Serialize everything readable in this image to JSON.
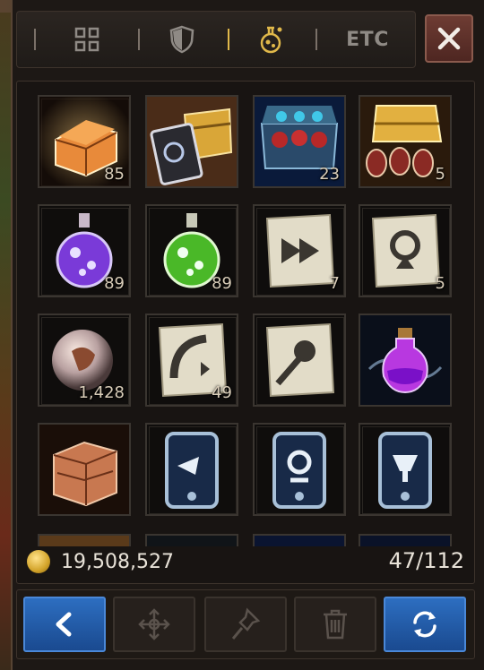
{
  "tabs": [
    {
      "label": "",
      "icon": "grid-icon"
    },
    {
      "label": "",
      "icon": "shield-icon"
    },
    {
      "label": "",
      "icon": "potion-icon",
      "active": true
    },
    {
      "label": "ETC",
      "icon": ""
    }
  ],
  "close_icon": "close-icon",
  "accent_color": "#e0b84a",
  "items": [
    {
      "name": "treasure-chest-icon",
      "qty": "85"
    },
    {
      "name": "chest-with-card-icon",
      "qty": ""
    },
    {
      "name": "gem-chest-icon",
      "qty": "23"
    },
    {
      "name": "golden-chest-icon",
      "qty": "5"
    },
    {
      "name": "purple-potion-icon",
      "qty": "89"
    },
    {
      "name": "green-potion-icon",
      "qty": "89"
    },
    {
      "name": "scroll-arrows-icon",
      "qty": "7"
    },
    {
      "name": "scroll-rune-icon",
      "qty": "5"
    },
    {
      "name": "dragon-orb-icon",
      "qty": "1,428"
    },
    {
      "name": "scroll-curve-icon",
      "qty": "49"
    },
    {
      "name": "scroll-arrow-icon",
      "qty": ""
    },
    {
      "name": "magic-elixir-icon",
      "qty": ""
    },
    {
      "name": "wooden-chest-icon",
      "qty": ""
    },
    {
      "name": "skill-card-wave-icon",
      "qty": ""
    },
    {
      "name": "skill-card-spiral-icon",
      "qty": ""
    },
    {
      "name": "skill-card-cup-icon",
      "qty": ""
    }
  ],
  "gold": "19,508,527",
  "capacity": "47/112",
  "bottom_buttons": [
    {
      "icon": "back-arrow-icon"
    },
    {
      "icon": "move-icon"
    },
    {
      "icon": "pin-icon"
    },
    {
      "icon": "trash-icon"
    },
    {
      "icon": "sort-icon"
    }
  ]
}
